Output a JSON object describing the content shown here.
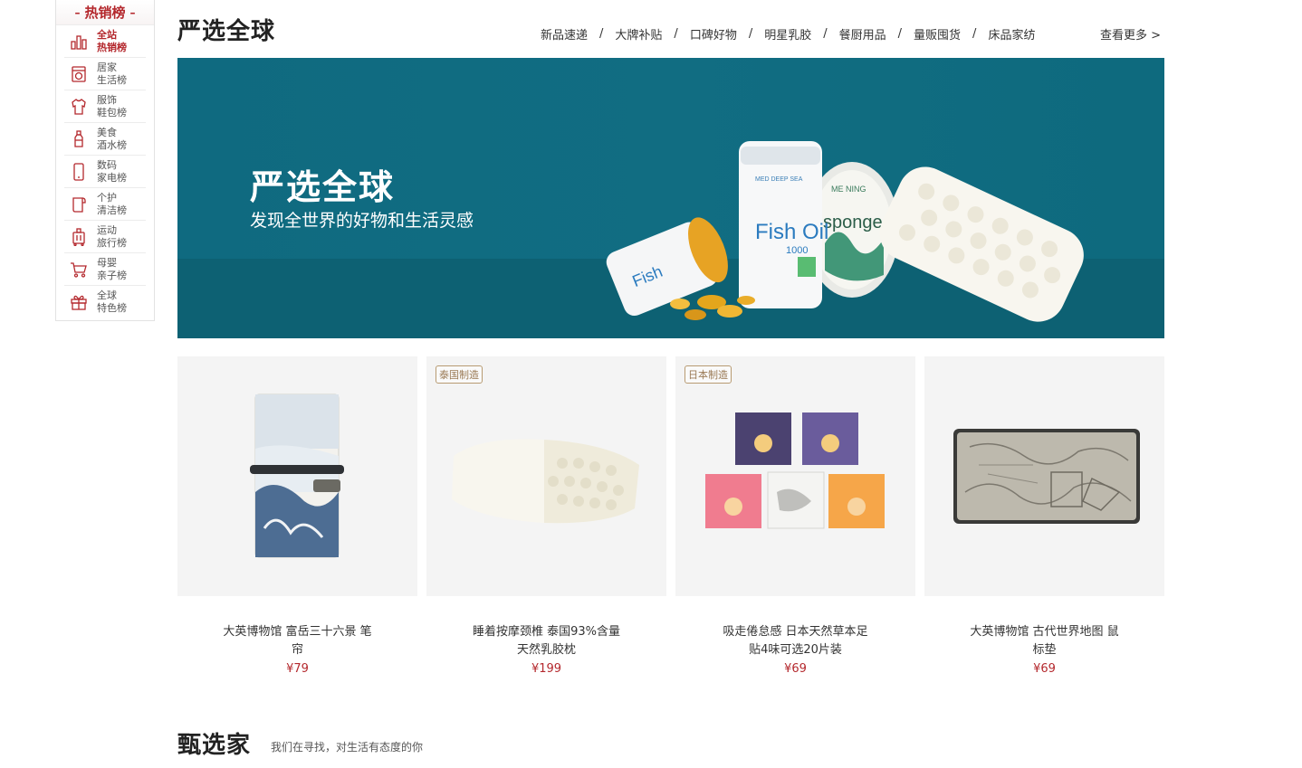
{
  "rank_menu": {
    "title": "热销榜",
    "items": [
      {
        "line1": "全站",
        "line2": "热销榜",
        "icon": "bar-chart-icon",
        "active": true
      },
      {
        "line1": "居家",
        "line2": "生活榜",
        "icon": "washer-icon",
        "active": false
      },
      {
        "line1": "服饰",
        "line2": "鞋包榜",
        "icon": "shirt-icon",
        "active": false
      },
      {
        "line1": "美食",
        "line2": "酒水榜",
        "icon": "bottle-icon",
        "active": false
      },
      {
        "line1": "数码",
        "line2": "家电榜",
        "icon": "phone-icon",
        "active": false
      },
      {
        "line1": "个护",
        "line2": "清洁榜",
        "icon": "towel-icon",
        "active": false
      },
      {
        "line1": "运动",
        "line2": "旅行榜",
        "icon": "suitcase-icon",
        "active": false
      },
      {
        "line1": "母婴",
        "line2": "亲子榜",
        "icon": "cart-icon",
        "active": false
      },
      {
        "line1": "全球",
        "line2": "特色榜",
        "icon": "gift-icon",
        "active": false
      }
    ]
  },
  "section": {
    "title": "严选全球",
    "nav": [
      "新品速递",
      "大牌补贴",
      "口碑好物",
      "明星乳胶",
      "餐厨用品",
      "量贩囤货",
      "床品家纺"
    ],
    "more": "查看更多 >"
  },
  "banner": {
    "title": "严选全球",
    "subtitle": "发现全世界的好物和生活灵感",
    "bg_color": "#116d82",
    "bottle_text": "Fish Oil",
    "bottle_number": "1000",
    "bottle_top_text": "MED DEEP SEA",
    "tin_text": "sponge",
    "tin_top_text": "ME NING"
  },
  "products": [
    {
      "name": "大英博物馆 富岳三十六景 笔帘",
      "price": "¥79",
      "tag": ""
    },
    {
      "name": "睡着按摩颈椎 泰国93%含量天然乳胶枕",
      "price": "¥199",
      "tag": "泰国制造"
    },
    {
      "name": "吸走倦怠感 日本天然草本足贴4味可选20片装",
      "price": "¥69",
      "tag": "日本制造"
    },
    {
      "name": "大英博物馆 古代世界地图 鼠标垫",
      "price": "¥69",
      "tag": ""
    }
  ],
  "section2": {
    "title": "甄选家",
    "subtitle": "我们在寻找，对生活有态度的你"
  },
  "colors": {
    "accent": "#b4282d",
    "banner": "#116d82"
  }
}
